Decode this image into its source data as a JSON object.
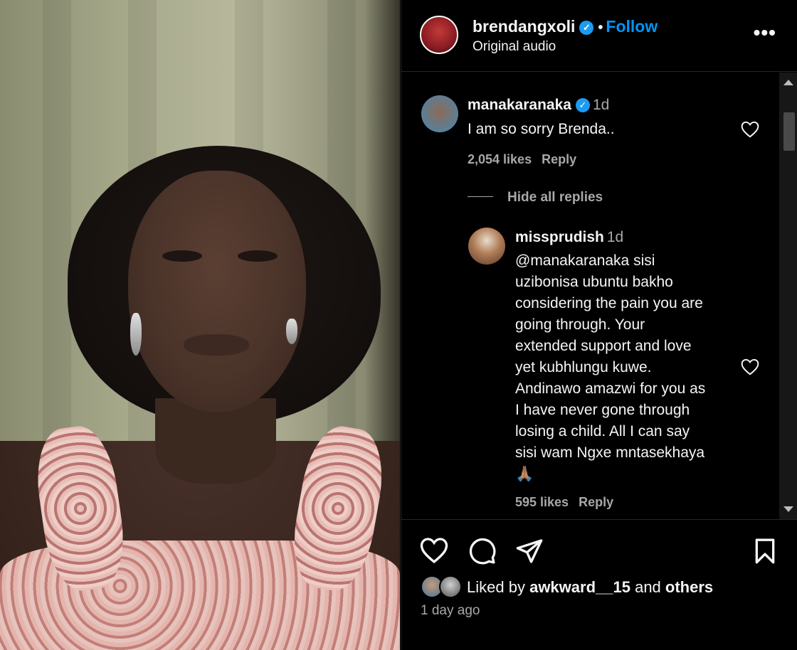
{
  "post": {
    "username": "brendangxoli",
    "verified_mark": "✓",
    "dot": "•",
    "follow_label": "Follow",
    "audio_label": "Original audio",
    "more_label": "•••"
  },
  "comments": [
    {
      "username": "manakaranaka",
      "time": "1d",
      "text": "I am so sorry Brenda..",
      "likes": "2,054 likes",
      "reply_label": "Reply"
    },
    {
      "username": "missprudish",
      "time": "1d",
      "text_lines": [
        "@manakaranaka sisi",
        "uzibonisa ubuntu bakho",
        "considering the pain you are",
        "going through. Your",
        "extended support and love",
        "yet kubhlungu kuwe.",
        "Andinawo amazwi for you as",
        "I have never gone through",
        "losing a child. All I can say",
        "sisi wam Ngxe mntasekhaya",
        "🙏🏽"
      ],
      "likes": "595 likes",
      "reply_label": "Reply"
    }
  ],
  "hide_replies_label": "Hide all replies",
  "footer": {
    "liked_prefix": "Liked by",
    "liked_user": "awkward__15",
    "liked_and": "and",
    "liked_others": "others",
    "time_ago": "1 day ago"
  },
  "icons": {
    "like": "heart-icon",
    "comment": "comment-icon",
    "share": "send-icon",
    "save": "bookmark-icon"
  },
  "colors": {
    "background": "#000000",
    "text": "#f5f5f5",
    "secondary_text": "#a8a8a8",
    "link_blue": "#0095f6",
    "verified_blue": "#1d9bf0"
  }
}
